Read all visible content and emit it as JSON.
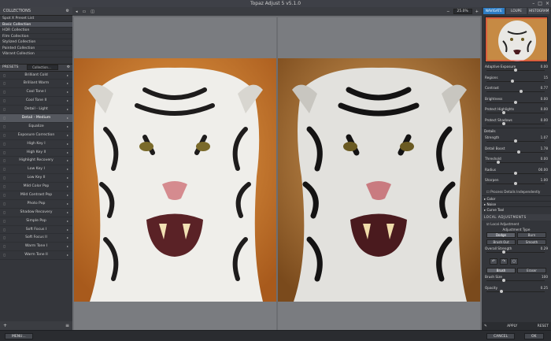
{
  "window": {
    "title": "Topaz Adjust 5 v5.1.0",
    "controls": [
      "–",
      "□",
      "×"
    ]
  },
  "collections": {
    "title": "COLLECTIONS",
    "items": [
      "Spot X Preset List",
      "Basic Collection",
      "HDR Collection",
      "Film Collection",
      "Stylized Collection",
      "Painted Collection",
      "Vibrant Collection"
    ],
    "selected_index": 1
  },
  "presets": {
    "title": "PRESETS",
    "combo_placeholder": "Collection...",
    "items": [
      "Brilliant Cold",
      "Brilliant Warm",
      "Cool Tone I",
      "Cool Tone II",
      "Detail - Light",
      "Detail - Medium",
      "Equalize",
      "Exposure Correction",
      "High Key I",
      "High Key II",
      "Highlight Recovery",
      "Low Key I",
      "Low Key II",
      "Mild Color Pop",
      "Mild Contrast Pop",
      "Photo Pop",
      "Shadow Recovery",
      "Simple Pop",
      "Soft Focus I",
      "Soft Focus II",
      "Warm Tone I",
      "Warm Tone II"
    ],
    "selected_index": 5
  },
  "left_footer": {
    "add": "+",
    "view": "≡"
  },
  "toolbar": {
    "zoom_value": "25.0%",
    "zoom_minus": "−",
    "zoom_plus": "+"
  },
  "right": {
    "tabs": [
      "NAVIGATE",
      "LOUPE",
      "HISTOGRAM"
    ],
    "active_tab": 0,
    "sliders": [
      {
        "label": "Adaptive Exposure",
        "value": "0.00",
        "pos": 0.5
      },
      {
        "label": "Regions",
        "value": "15",
        "pos": 0.45
      },
      {
        "label": "Contrast",
        "value": "0.77",
        "pos": 0.6
      },
      {
        "label": "Brightness",
        "value": "0.00",
        "pos": 0.5
      },
      {
        "label": "Protect Highlights",
        "value": "0.00",
        "pos": 0.3
      },
      {
        "label": "Protect Shadows",
        "value": "0.00",
        "pos": 0.3
      }
    ],
    "details_label": "Details",
    "details_sliders": [
      {
        "label": "Strength",
        "value": "1.07",
        "pos": 0.5
      },
      {
        "label": "Detail Boost",
        "value": "1.78",
        "pos": 0.55
      },
      {
        "label": "Threshold",
        "value": "0.00",
        "pos": 0.2
      },
      {
        "label": "Radius",
        "value": "00.00",
        "pos": 0.5
      },
      {
        "label": "Sharpen",
        "value": "1.00",
        "pos": 0.5
      }
    ],
    "process_label": "Process Details Independently",
    "sections": [
      "Color",
      "Noise",
      "Curve Tool"
    ],
    "local_header": "LOCAL ADJUSTMENTS",
    "local_label": "Local Adjustment",
    "adjust_type_label": "Adjustment Type",
    "adjust_buttons": [
      "Dodge",
      "Burn",
      "Brush Out",
      "Smooth"
    ],
    "overall_label": "Overall Strength",
    "overall_value": "0.29",
    "overall_pos": 0.3,
    "brush_buttons": [
      "Brush",
      "Eraser"
    ],
    "brush_sliders": [
      {
        "label": "Brush Size",
        "value": "100",
        "pos": 0.3
      },
      {
        "label": "Opacity",
        "value": "0.25",
        "pos": 0.25
      }
    ],
    "apply_label": "APPLY",
    "reset_label": "RESET"
  },
  "bottom": {
    "menu": "MENU...",
    "cancel": "CANCEL",
    "ok": "OK"
  }
}
